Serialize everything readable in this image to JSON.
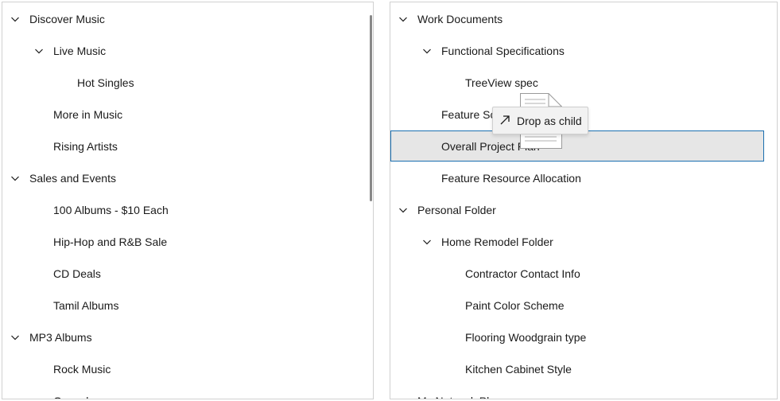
{
  "left_tree": {
    "items": [
      {
        "label": "Discover Music",
        "level": 0,
        "expanded": true
      },
      {
        "label": "Live Music",
        "level": 1,
        "expanded": true
      },
      {
        "label": "Hot Singles",
        "level": 2
      },
      {
        "label": "More in Music",
        "level": 1
      },
      {
        "label": "Rising Artists",
        "level": 1
      },
      {
        "label": "Sales and Events",
        "level": 0,
        "expanded": true
      },
      {
        "label": "100 Albums - $10 Each",
        "level": 1
      },
      {
        "label": "Hip-Hop and R&B Sale",
        "level": 1
      },
      {
        "label": "CD Deals",
        "level": 1
      },
      {
        "label": "Tamil Albums",
        "level": 1
      },
      {
        "label": "MP3 Albums",
        "level": 0,
        "expanded": true
      },
      {
        "label": "Rock Music",
        "level": 1
      },
      {
        "label": "Gospel",
        "level": 1
      }
    ]
  },
  "right_tree": {
    "items": [
      {
        "label": "Work Documents",
        "level": 0,
        "expanded": true
      },
      {
        "label": "Functional Specifications",
        "level": 1,
        "expanded": true
      },
      {
        "label": "TreeView spec",
        "level": 2
      },
      {
        "label": "Feature Schedule",
        "level": 1
      },
      {
        "label": "Overall Project Plan",
        "level": 1
      },
      {
        "label": "Feature Resource Allocation",
        "level": 1
      },
      {
        "label": "Personal Folder",
        "level": 0,
        "expanded": true
      },
      {
        "label": "Home Remodel Folder",
        "level": 1,
        "expanded": true
      },
      {
        "label": "Contractor Contact Info",
        "level": 2
      },
      {
        "label": "Paint Color Scheme",
        "level": 2
      },
      {
        "label": "Flooring Woodgrain type",
        "level": 2
      },
      {
        "label": "Kitchen Cabinet Style",
        "level": 2
      },
      {
        "label": "My Network Places",
        "level": 0,
        "expanded": true
      }
    ]
  },
  "drag": {
    "tooltip_text": "Drop as child",
    "icon": "arrow-up-right-icon",
    "doc_icon": "document-icon"
  },
  "colors": {
    "drop_target_fill": "#e6e6e6",
    "drop_target_border": "#1a6fb0"
  }
}
